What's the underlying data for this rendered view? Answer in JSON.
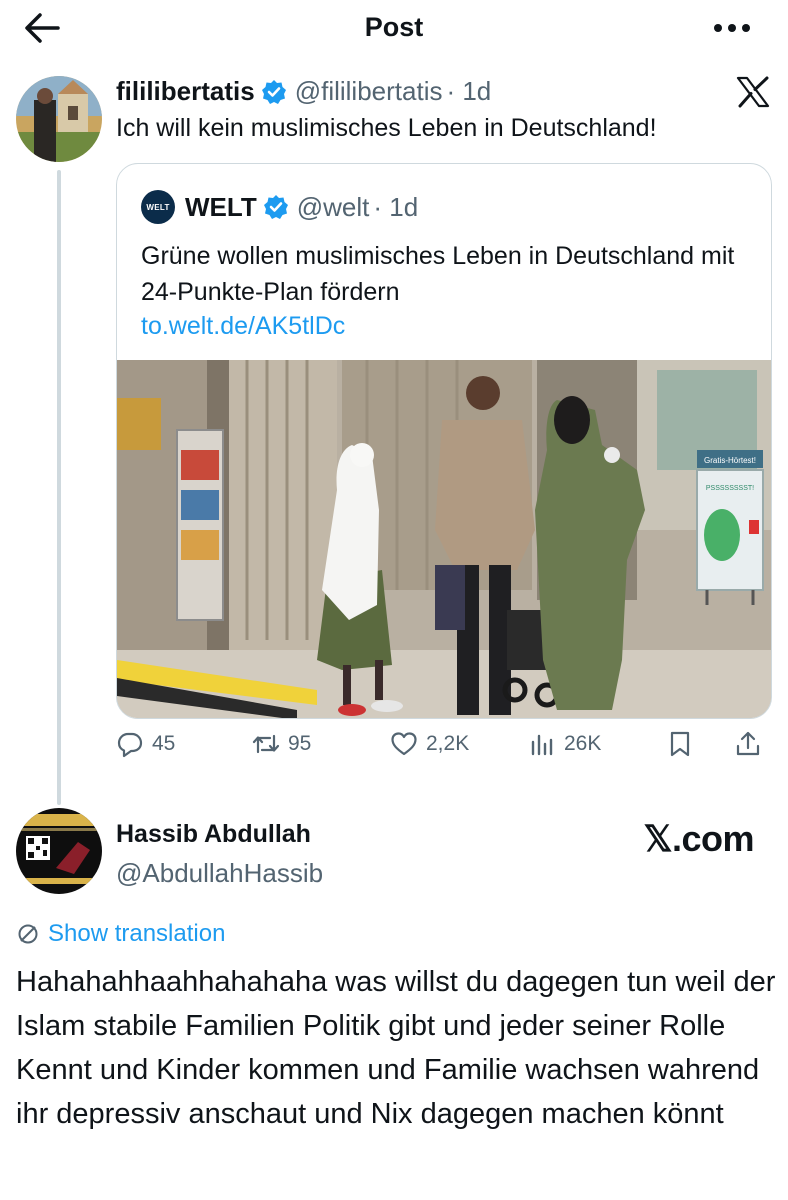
{
  "header": {
    "title": "Post",
    "back_icon": "arrow-left-icon",
    "more_icon": "more-horizontal-icon"
  },
  "post": {
    "author_name": "fililibertatis",
    "handle": "@fililibertatis",
    "time": "· 1d",
    "text": "Ich will kein muslimisches Leben in Deutschland!",
    "platform_icon": "x-logo-icon"
  },
  "quote": {
    "logo_text": "WELT",
    "author_name": "WELT",
    "handle": "@welt",
    "time": "· 1d",
    "text": "Grüne wollen muslimisches Leben in Deutschland mit 24-Punkte-Plan fördern",
    "link": "to.welt.de/AK5tlDc",
    "image_sign": {
      "title": "Gratis-Hörtest!",
      "text": "PSSSSSSSST!"
    }
  },
  "actions": {
    "replies": "45",
    "reposts": "95",
    "likes": "2,2K",
    "views": "26K"
  },
  "reply": {
    "author_name": "Hassib Abdullah",
    "handle": "@AbdullahHassib",
    "watermark": "𝕏.com",
    "translate_label": "Show translation",
    "text": "Hahahahhaahhahahaha was willst du dagegen tun weil der Islam stabile Familien Politik gibt und jeder seiner Rolle Kennt und Kinder kommen und Familie wachsen wahrend ihr depressiv anschaut und Nix dagegen machen könnt"
  },
  "colors": {
    "accent": "#1d9bf0",
    "secondary_text": "#536471",
    "border": "#cfd9de"
  }
}
